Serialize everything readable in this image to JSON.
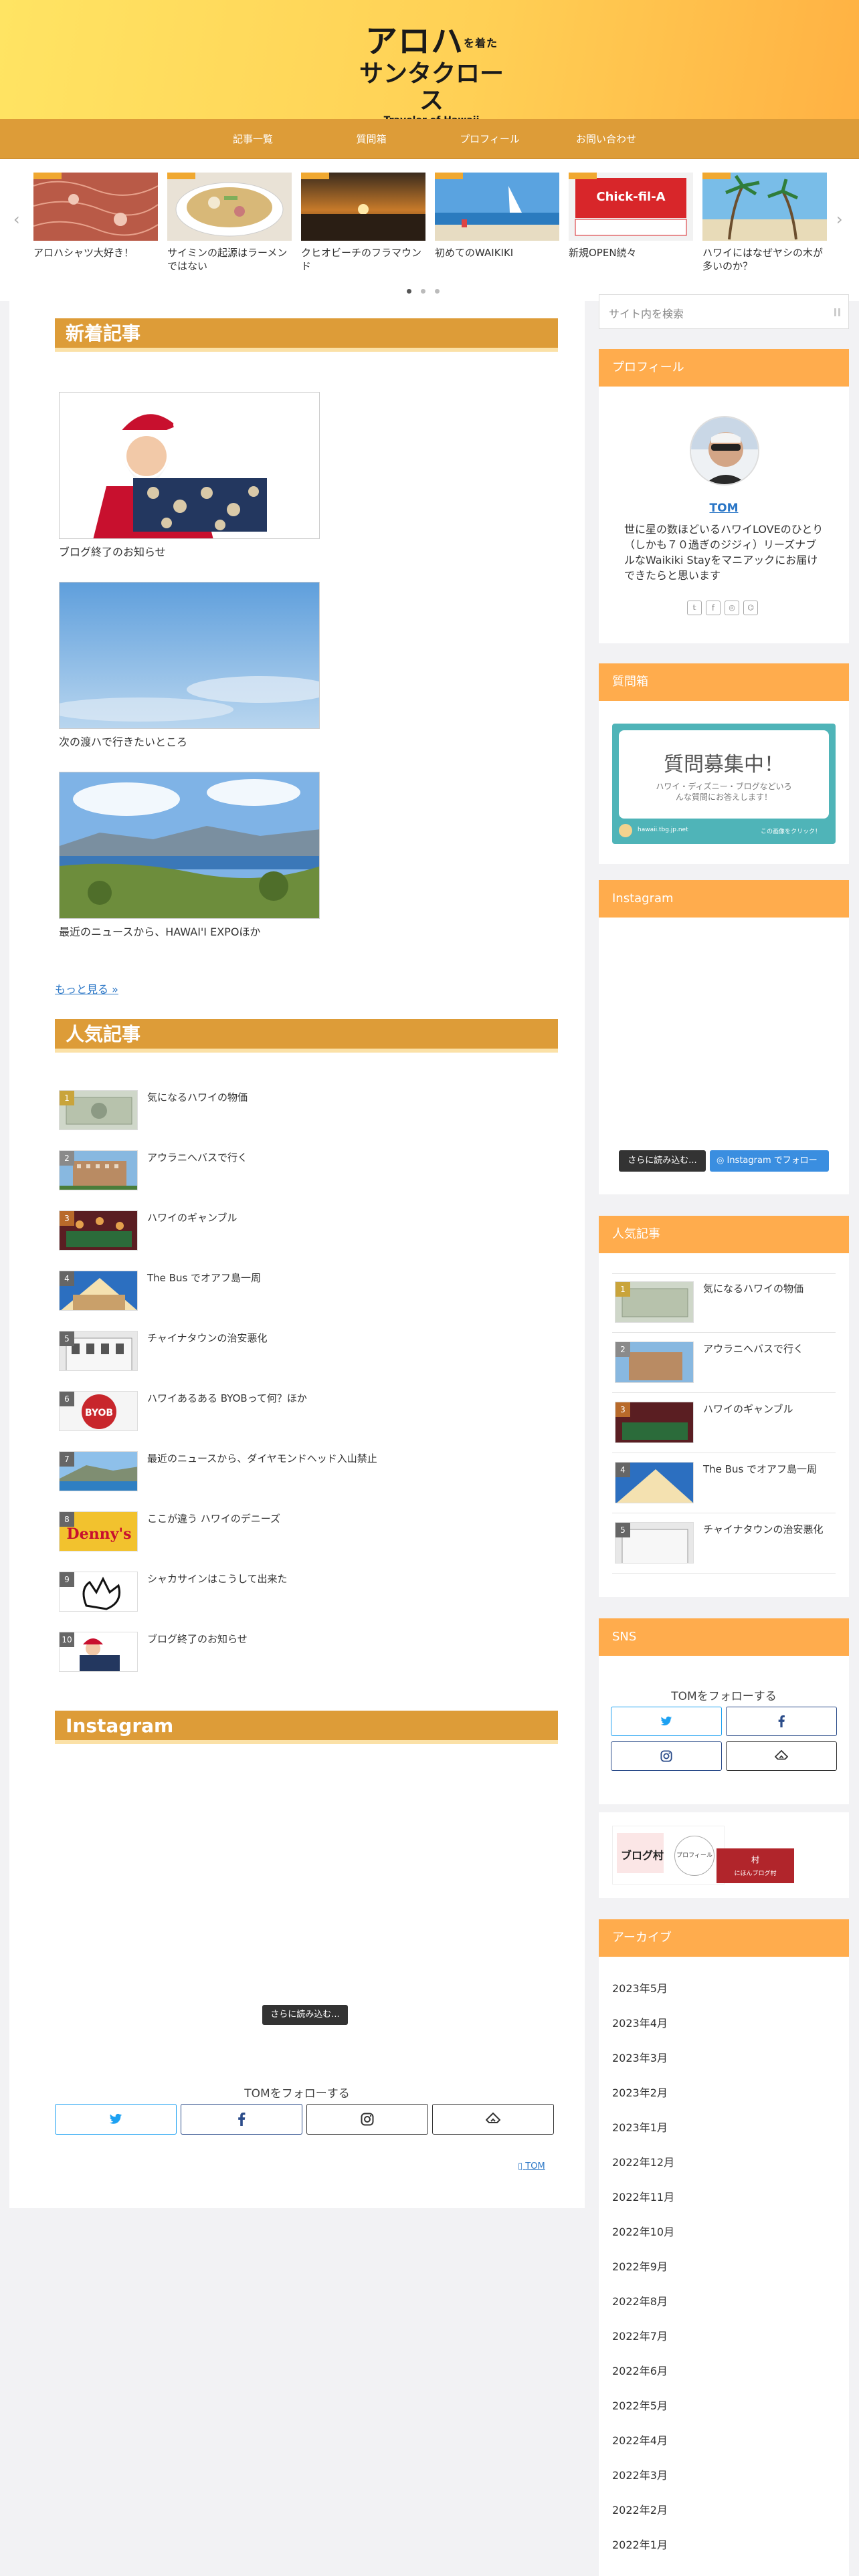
{
  "site": {
    "logo_line1": "アロハ",
    "logo_small": "を着た",
    "logo_line2": "サンタクロース",
    "logo_line3": "Traveler of Hawaii"
  },
  "nav": [
    "記事一覧",
    "質問箱",
    "プロフィール",
    "お問い合わせ"
  ],
  "carousel": [
    "アロハシャツ大好き！",
    "サイミンの起源はラーメンではない",
    "クヒオビーチのフラマウンド",
    "初めてのWAIKIKI",
    "新規OPEN続々",
    "ハワイにはなぜヤシの木が多いのか？"
  ],
  "main": {
    "new_heading": "新着記事",
    "new_posts": [
      "ブログ終了のお知らせ",
      "次の渡ハで行きたいところ",
      "最近のニュースから、HAWAI'I EXPOほか"
    ],
    "more": "もっと見る »",
    "popular_heading": "人気記事",
    "popular": [
      "気になるハワイの物価",
      "アウラニへバスで行く",
      "ハワイのギャンブル",
      "The Bus でオアフ島一周",
      "チャイナタウンの治安悪化",
      "ハワイあるある BYOBって何？ほか",
      "最近のニュースから、ダイヤモンドヘッド入山禁止",
      "ここが違う ハワイのデニーズ",
      "シャカサインはこうして出来た",
      "ブログ終了のお知らせ"
    ],
    "ranks": [
      "1",
      "2",
      "3",
      "4",
      "5",
      "6",
      "7",
      "8",
      "9",
      "10"
    ],
    "instagram_heading": "Instagram",
    "instagram_more": "さらに読み込む...",
    "follow_text": "TOMをフォローする",
    "author": "TOM"
  },
  "sidebar": {
    "search_placeholder": "サイト内を検索",
    "profile_heading": "プロフィール",
    "profile_name": "TOM",
    "profile_bio": "世に星の数ほどいるハワイLOVEのひとり（しかも７０過ぎのジジィ）リーズナブルなWaikiki Stayをマニアックにお届けできたらと思います",
    "question_heading": "質問箱",
    "question_title": "質問募集中！",
    "question_sub": "ハワイ・ディズニー・ブログなどいろんな質問にお答えします！",
    "question_foot_left": "hawaii.tbg.jp.net",
    "question_foot_right": "この画像をクリック！",
    "instagram_heading": "Instagram",
    "instagram_more": "さらに読み込む...",
    "instagram_follow": "Instagram でフォロー",
    "popular_heading": "人気記事",
    "popular": [
      "気になるハワイの物価",
      "アウラニへバスで行く",
      "ハワイのギャンブル",
      "The Bus でオアフ島一周",
      "チャイナタウンの治安悪化"
    ],
    "sns_heading": "SNS",
    "sns_follow": "TOMをフォローする",
    "blogmura_label": "ブログ村",
    "blogmura_label2": "プロフィール",
    "blogmura_badge": "にほんブログ村",
    "archive_heading": "アーカイブ",
    "archives": [
      "2023年5月",
      "2023年4月",
      "2023年3月",
      "2023年2月",
      "2023年1月",
      "2022年12月",
      "2022年11月",
      "2022年10月",
      "2022年9月",
      "2022年8月",
      "2022年7月",
      "2022年6月",
      "2022年5月",
      "2022年4月",
      "2022年3月",
      "2022年2月",
      "2022年1月"
    ]
  },
  "colors": {
    "header_gradient_start": "#ffe463",
    "header_gradient_end": "#ffb143",
    "nav": "#dd9c38",
    "sidebar_heading": "#ffac4d",
    "link": "#2a76c6"
  }
}
